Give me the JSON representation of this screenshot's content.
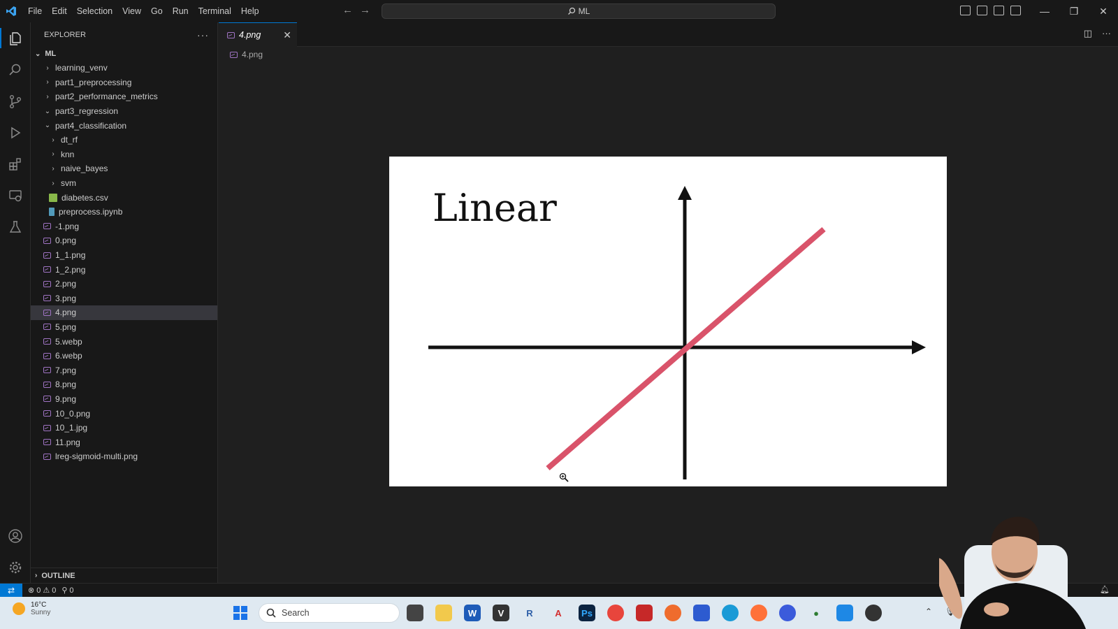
{
  "titlebar": {
    "menu": [
      "File",
      "Edit",
      "Selection",
      "View",
      "Go",
      "Run",
      "Terminal",
      "Help"
    ],
    "search": "ML"
  },
  "sidebar": {
    "header": "EXPLORER",
    "root": "ML",
    "items": [
      {
        "label": "learning_venv",
        "type": "folder",
        "indent": 1,
        "open": false
      },
      {
        "label": "part1_preprocessing",
        "type": "folder",
        "indent": 1,
        "open": false
      },
      {
        "label": "part2_performance_metrics",
        "type": "folder",
        "indent": 1,
        "open": false
      },
      {
        "label": "part3_regression",
        "type": "folder",
        "indent": 1,
        "open": true
      },
      {
        "label": "part4_classification",
        "type": "folder",
        "indent": 1,
        "open": true
      },
      {
        "label": "dt_rf",
        "type": "folder",
        "indent": 2,
        "open": false
      },
      {
        "label": "knn",
        "type": "folder",
        "indent": 2,
        "open": false
      },
      {
        "label": "naive_bayes",
        "type": "folder",
        "indent": 2,
        "open": false
      },
      {
        "label": "svm",
        "type": "folder",
        "indent": 2,
        "open": false
      },
      {
        "label": "diabetes.csv",
        "type": "csv",
        "indent": 2
      },
      {
        "label": "preprocess.ipynb",
        "type": "notebook",
        "indent": 2
      },
      {
        "label": "-1.png",
        "type": "image",
        "indent": 1
      },
      {
        "label": "0.png",
        "type": "image",
        "indent": 1
      },
      {
        "label": "1_1.png",
        "type": "image",
        "indent": 1
      },
      {
        "label": "1_2.png",
        "type": "image",
        "indent": 1
      },
      {
        "label": "2.png",
        "type": "image",
        "indent": 1
      },
      {
        "label": "3.png",
        "type": "image",
        "indent": 1
      },
      {
        "label": "4.png",
        "type": "image",
        "indent": 1,
        "selected": true
      },
      {
        "label": "5.png",
        "type": "image",
        "indent": 1
      },
      {
        "label": "5.webp",
        "type": "image",
        "indent": 1
      },
      {
        "label": "6.webp",
        "type": "image",
        "indent": 1
      },
      {
        "label": "7.png",
        "type": "image",
        "indent": 1
      },
      {
        "label": "8.png",
        "type": "image",
        "indent": 1
      },
      {
        "label": "9.png",
        "type": "image",
        "indent": 1
      },
      {
        "label": "10_0.png",
        "type": "image",
        "indent": 1
      },
      {
        "label": "10_1.jpg",
        "type": "image",
        "indent": 1
      },
      {
        "label": "11.png",
        "type": "image",
        "indent": 1
      },
      {
        "label": "lreg-sigmoid-multi.png",
        "type": "image",
        "indent": 1
      }
    ],
    "outline": "OUTLINE"
  },
  "editor": {
    "tab_label": "4.png",
    "breadcrumb": "4.png",
    "image_title": "Linear"
  },
  "statusbar": {
    "errors": "0",
    "warnings": "0",
    "ports": "0"
  },
  "taskbar": {
    "temperature": "16°C",
    "weather": "Sunny",
    "search": "Search"
  },
  "colors": {
    "accent": "#0078d4",
    "line": "#d9536a",
    "image_icon": "#a074c4"
  }
}
